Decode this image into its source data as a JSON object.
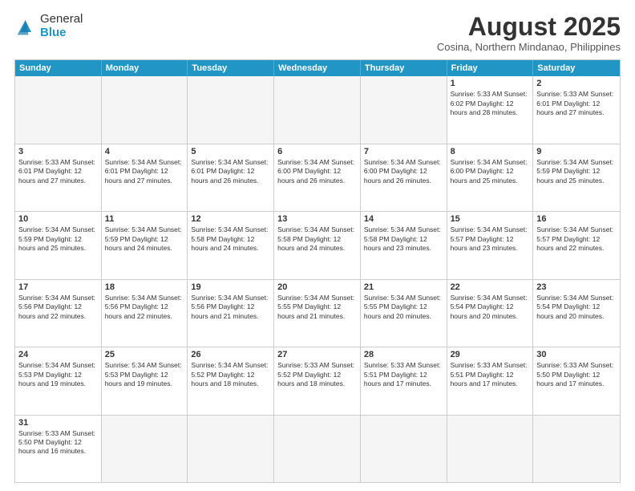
{
  "header": {
    "logo_general": "General",
    "logo_blue": "Blue",
    "month_year": "August 2025",
    "location": "Cosina, Northern Mindanao, Philippines"
  },
  "days_of_week": [
    "Sunday",
    "Monday",
    "Tuesday",
    "Wednesday",
    "Thursday",
    "Friday",
    "Saturday"
  ],
  "weeks": [
    [
      {
        "day": "",
        "info": ""
      },
      {
        "day": "",
        "info": ""
      },
      {
        "day": "",
        "info": ""
      },
      {
        "day": "",
        "info": ""
      },
      {
        "day": "",
        "info": ""
      },
      {
        "day": "1",
        "info": "Sunrise: 5:33 AM\nSunset: 6:02 PM\nDaylight: 12 hours and 28 minutes."
      },
      {
        "day": "2",
        "info": "Sunrise: 5:33 AM\nSunset: 6:01 PM\nDaylight: 12 hours and 27 minutes."
      }
    ],
    [
      {
        "day": "3",
        "info": "Sunrise: 5:33 AM\nSunset: 6:01 PM\nDaylight: 12 hours and 27 minutes."
      },
      {
        "day": "4",
        "info": "Sunrise: 5:34 AM\nSunset: 6:01 PM\nDaylight: 12 hours and 27 minutes."
      },
      {
        "day": "5",
        "info": "Sunrise: 5:34 AM\nSunset: 6:01 PM\nDaylight: 12 hours and 26 minutes."
      },
      {
        "day": "6",
        "info": "Sunrise: 5:34 AM\nSunset: 6:00 PM\nDaylight: 12 hours and 26 minutes."
      },
      {
        "day": "7",
        "info": "Sunrise: 5:34 AM\nSunset: 6:00 PM\nDaylight: 12 hours and 26 minutes."
      },
      {
        "day": "8",
        "info": "Sunrise: 5:34 AM\nSunset: 6:00 PM\nDaylight: 12 hours and 25 minutes."
      },
      {
        "day": "9",
        "info": "Sunrise: 5:34 AM\nSunset: 5:59 PM\nDaylight: 12 hours and 25 minutes."
      }
    ],
    [
      {
        "day": "10",
        "info": "Sunrise: 5:34 AM\nSunset: 5:59 PM\nDaylight: 12 hours and 25 minutes."
      },
      {
        "day": "11",
        "info": "Sunrise: 5:34 AM\nSunset: 5:59 PM\nDaylight: 12 hours and 24 minutes."
      },
      {
        "day": "12",
        "info": "Sunrise: 5:34 AM\nSunset: 5:58 PM\nDaylight: 12 hours and 24 minutes."
      },
      {
        "day": "13",
        "info": "Sunrise: 5:34 AM\nSunset: 5:58 PM\nDaylight: 12 hours and 24 minutes."
      },
      {
        "day": "14",
        "info": "Sunrise: 5:34 AM\nSunset: 5:58 PM\nDaylight: 12 hours and 23 minutes."
      },
      {
        "day": "15",
        "info": "Sunrise: 5:34 AM\nSunset: 5:57 PM\nDaylight: 12 hours and 23 minutes."
      },
      {
        "day": "16",
        "info": "Sunrise: 5:34 AM\nSunset: 5:57 PM\nDaylight: 12 hours and 22 minutes."
      }
    ],
    [
      {
        "day": "17",
        "info": "Sunrise: 5:34 AM\nSunset: 5:56 PM\nDaylight: 12 hours and 22 minutes."
      },
      {
        "day": "18",
        "info": "Sunrise: 5:34 AM\nSunset: 5:56 PM\nDaylight: 12 hours and 22 minutes."
      },
      {
        "day": "19",
        "info": "Sunrise: 5:34 AM\nSunset: 5:56 PM\nDaylight: 12 hours and 21 minutes."
      },
      {
        "day": "20",
        "info": "Sunrise: 5:34 AM\nSunset: 5:55 PM\nDaylight: 12 hours and 21 minutes."
      },
      {
        "day": "21",
        "info": "Sunrise: 5:34 AM\nSunset: 5:55 PM\nDaylight: 12 hours and 20 minutes."
      },
      {
        "day": "22",
        "info": "Sunrise: 5:34 AM\nSunset: 5:54 PM\nDaylight: 12 hours and 20 minutes."
      },
      {
        "day": "23",
        "info": "Sunrise: 5:34 AM\nSunset: 5:54 PM\nDaylight: 12 hours and 20 minutes."
      }
    ],
    [
      {
        "day": "24",
        "info": "Sunrise: 5:34 AM\nSunset: 5:53 PM\nDaylight: 12 hours and 19 minutes."
      },
      {
        "day": "25",
        "info": "Sunrise: 5:34 AM\nSunset: 5:53 PM\nDaylight: 12 hours and 19 minutes."
      },
      {
        "day": "26",
        "info": "Sunrise: 5:34 AM\nSunset: 5:52 PM\nDaylight: 12 hours and 18 minutes."
      },
      {
        "day": "27",
        "info": "Sunrise: 5:33 AM\nSunset: 5:52 PM\nDaylight: 12 hours and 18 minutes."
      },
      {
        "day": "28",
        "info": "Sunrise: 5:33 AM\nSunset: 5:51 PM\nDaylight: 12 hours and 17 minutes."
      },
      {
        "day": "29",
        "info": "Sunrise: 5:33 AM\nSunset: 5:51 PM\nDaylight: 12 hours and 17 minutes."
      },
      {
        "day": "30",
        "info": "Sunrise: 5:33 AM\nSunset: 5:50 PM\nDaylight: 12 hours and 17 minutes."
      }
    ],
    [
      {
        "day": "31",
        "info": "Sunrise: 5:33 AM\nSunset: 5:50 PM\nDaylight: 12 hours and 16 minutes."
      },
      {
        "day": "",
        "info": ""
      },
      {
        "day": "",
        "info": ""
      },
      {
        "day": "",
        "info": ""
      },
      {
        "day": "",
        "info": ""
      },
      {
        "day": "",
        "info": ""
      },
      {
        "day": "",
        "info": ""
      }
    ]
  ]
}
